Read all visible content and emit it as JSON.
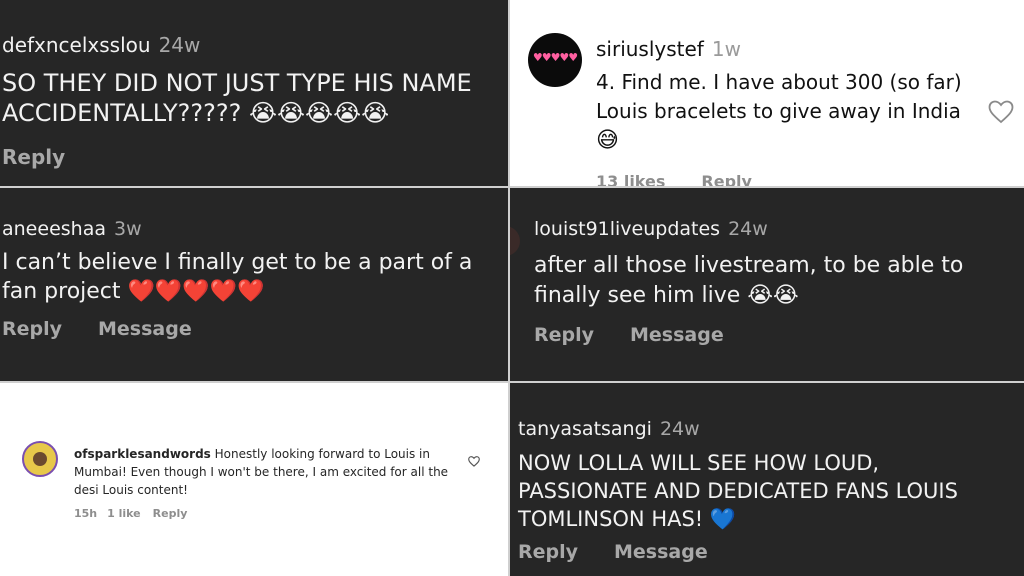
{
  "p1": {
    "username": "defxncelxsslou",
    "age": "24w",
    "text": "SO THEY DID NOT JUST TYPE HIS NAME ACCIDENTALLY?????",
    "emojis": "😭😭😭😭😭",
    "reply": "Reply"
  },
  "p2": {
    "header_partial": "",
    "username": "siriuslystef",
    "age": "1w",
    "text": "4. Find me. I have about 300 (so far) Louis bracelets to give away in India",
    "emojis": "😅",
    "likes": "13 likes",
    "reply": "Reply",
    "avatar_label": "♥♥♥♥♥"
  },
  "p3": {
    "username": "aneeeshaa",
    "age": "3w",
    "text": "I can’t believe I finally get to be a part of a fan project",
    "emojis": "❤️❤️❤️❤️❤️",
    "reply": "Reply",
    "message": "Message"
  },
  "p4": {
    "username": "louist91liveupdates",
    "age": "24w",
    "text": "after all those livestream, to be able to finally see him live",
    "emojis": "😭😭",
    "reply": "Reply",
    "message": "Message"
  },
  "p5": {
    "username": "ofsparklesandwords",
    "text": "Honestly looking forward to Louis in Mumbai! Even though I won't be there, I am excited for all the desi Louis content!",
    "age": "15h",
    "likes": "1 like",
    "reply": "Reply"
  },
  "p6": {
    "username": "tanyasatsangi",
    "age": "24w",
    "text": "NOW LOLLA WILL SEE HOW LOUD, PASSIONATE AND DEDICATED FANS LOUIS TOMLINSON HAS!",
    "emojis": "💙",
    "reply": "Reply",
    "message": "Message"
  },
  "colors": {
    "dark_bg": "#262626",
    "light_bg": "#ffffff",
    "muted": "#a8a8a8",
    "heart": "#e0262b"
  }
}
